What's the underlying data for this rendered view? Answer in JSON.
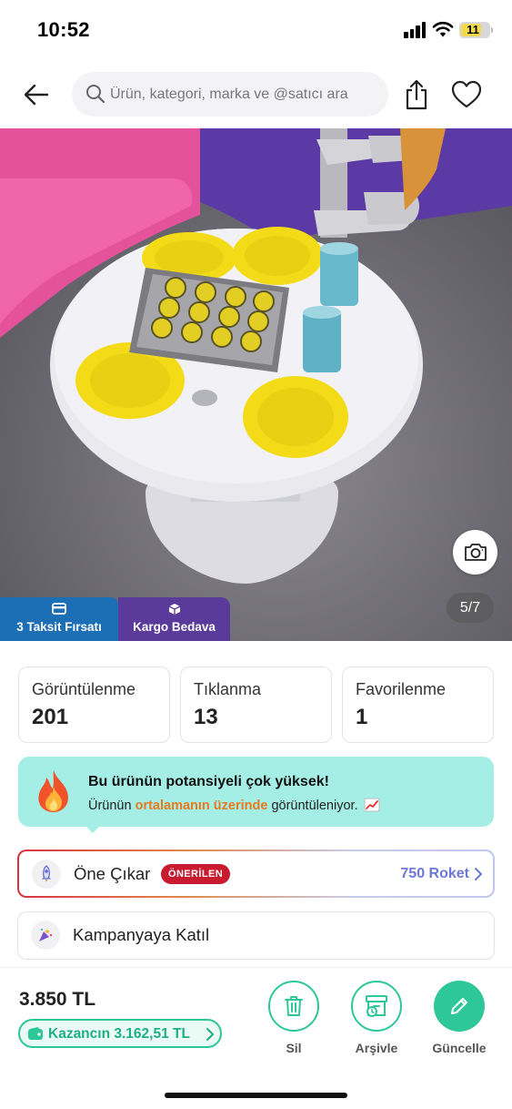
{
  "status_bar": {
    "time": "10:52",
    "battery_level": "11",
    "battery_color": "#f2d94e"
  },
  "header": {
    "search_placeholder": "Ürün, kategori, marka ve @satıcı ara",
    "icons": [
      "back-arrow-icon",
      "search-icon",
      "share-icon",
      "heart-icon"
    ]
  },
  "gallery": {
    "counter": "5/7",
    "badges": [
      {
        "label": "3 Taksit Fırsatı",
        "icon": "card-icon",
        "color": "#1c6fb5"
      },
      {
        "label": "Kargo Bedava",
        "icon": "box-icon",
        "color": "#5a3a9b"
      }
    ]
  },
  "stats": [
    {
      "label": "Görüntülenme",
      "value": "201"
    },
    {
      "label": "Tıklanma",
      "value": "13"
    },
    {
      "label": "Favorilenme",
      "value": "1"
    }
  ],
  "promo": {
    "title": "Bu ürünün potansiyeli çok yüksek!",
    "text_before": "Ürünün",
    "highlight": "ortalamanın üzerinde",
    "text_after": "görüntüleniyor.",
    "bg_color": "#a5eee6",
    "highlight_color": "#e8791e"
  },
  "actions": {
    "one_cikar": {
      "label": "Öne Çıkar",
      "badge": "ÖNERİLEN",
      "price": "750 Roket"
    },
    "kampanya": {
      "label": "Kampanyaya Katıl"
    }
  },
  "footer": {
    "price": "3.850 TL",
    "earnings": "Kazancın 3.162,51 TL",
    "buttons": [
      {
        "label": "Sil",
        "icon": "trash-icon"
      },
      {
        "label": "Arşivle",
        "icon": "archive-icon"
      },
      {
        "label": "Güncelle",
        "icon": "pencil-icon"
      }
    ],
    "accent_color": "#2ec79a"
  }
}
